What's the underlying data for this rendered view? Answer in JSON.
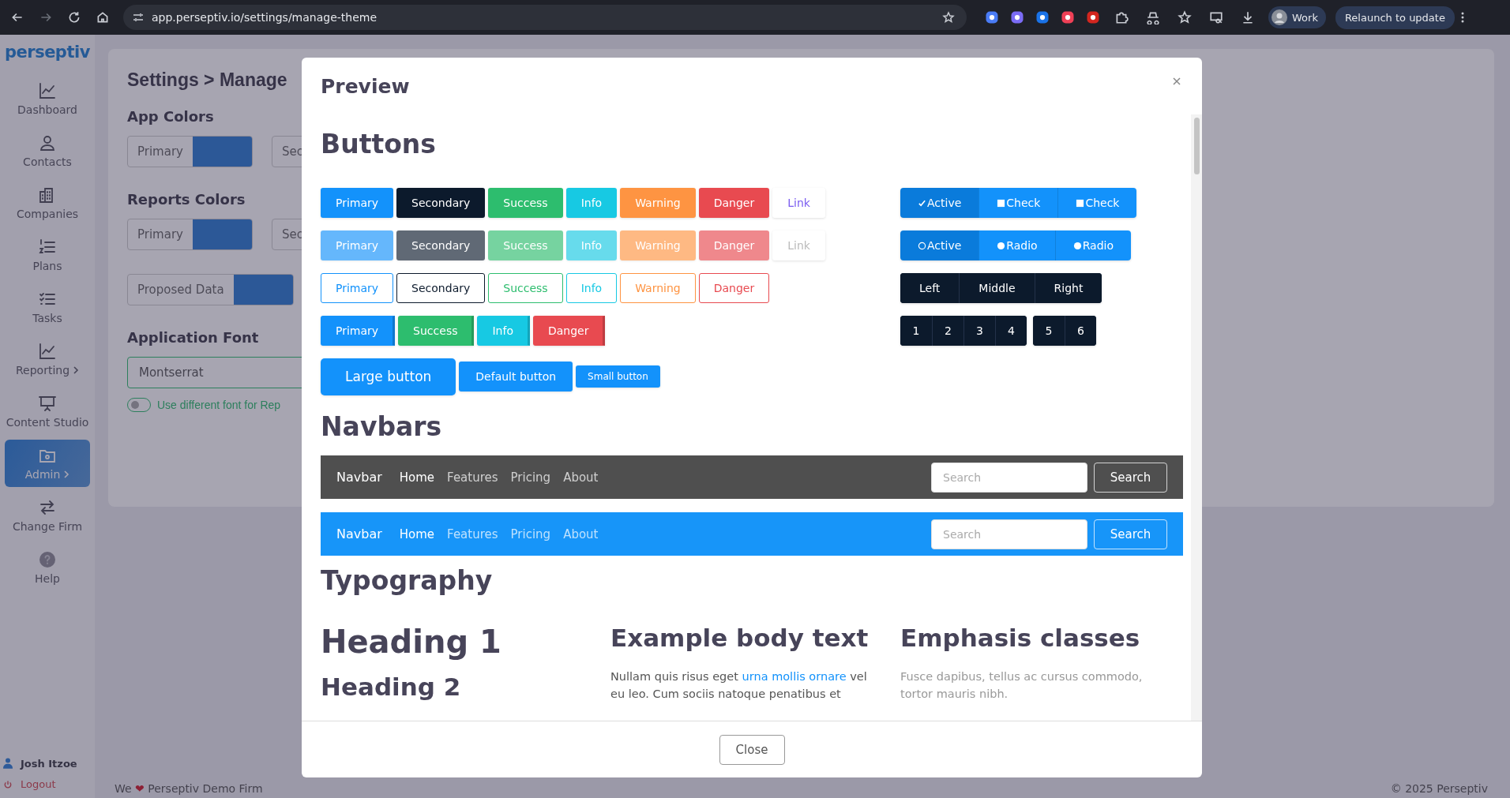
{
  "browser": {
    "url": "app.perseptiv.io/settings/manage-theme",
    "profile": "Work",
    "relaunch": "Relaunch to update"
  },
  "sidebar": {
    "logo": "perseptiv",
    "items": [
      {
        "label": "Dashboard",
        "submenu": false,
        "selected": false
      },
      {
        "label": "Contacts",
        "submenu": false,
        "selected": false
      },
      {
        "label": "Companies",
        "submenu": false,
        "selected": false
      },
      {
        "label": "Plans",
        "submenu": false,
        "selected": false
      },
      {
        "label": "Tasks",
        "submenu": false,
        "selected": false
      },
      {
        "label": "Reporting",
        "submenu": true,
        "selected": false
      },
      {
        "label": "Content Studio",
        "submenu": false,
        "selected": false
      },
      {
        "label": "Admin",
        "submenu": true,
        "selected": true
      },
      {
        "label": "Change Firm",
        "submenu": false,
        "selected": false
      },
      {
        "label": "Help",
        "submenu": false,
        "selected": false
      }
    ],
    "user": "Josh Itzoe",
    "logout": "Logout"
  },
  "settings": {
    "title": "Settings > Manage",
    "sections": [
      {
        "heading": "App Colors",
        "rows": [
          [
            "Primary",
            "Sec"
          ]
        ]
      },
      {
        "heading": "Reports Colors",
        "rows": [
          [
            "Primary",
            "Sec"
          ],
          [
            "Proposed Data"
          ]
        ]
      }
    ],
    "font": {
      "heading": "Application Font",
      "value": "Montserrat",
      "toggle": {
        "on": false,
        "label": "Use different font for Rep"
      }
    }
  },
  "footer": {
    "left_before": "We",
    "heart": "❤",
    "left_after": "Perseptiv Demo Firm",
    "right": "© 2025 Perseptiv"
  },
  "modal": {
    "title": "Preview",
    "close_button": "Close",
    "buttons": {
      "heading": "Buttons",
      "rows": [
        {
          "kind": "solid",
          "items": [
            {
              "label": "Primary",
              "kind": "primary"
            },
            {
              "label": "Secondary",
              "kind": "secondary"
            },
            {
              "label": "Success",
              "kind": "success"
            },
            {
              "label": "Info",
              "kind": "info"
            },
            {
              "label": "Warning",
              "kind": "warning"
            },
            {
              "label": "Danger",
              "kind": "danger"
            },
            {
              "label": "Link",
              "kind": "link"
            }
          ]
        },
        {
          "kind": "disabled",
          "items": [
            {
              "label": "Primary",
              "kind": "primary"
            },
            {
              "label": "Secondary",
              "kind": "secondary"
            },
            {
              "label": "Success",
              "kind": "success"
            },
            {
              "label": "Info",
              "kind": "info"
            },
            {
              "label": "Warning",
              "kind": "warning"
            },
            {
              "label": "Danger",
              "kind": "danger"
            },
            {
              "label": "Link",
              "kind": "link"
            }
          ]
        },
        {
          "kind": "outline",
          "items": [
            {
              "label": "Primary",
              "kind": "primary"
            },
            {
              "label": "Secondary",
              "kind": "secondary"
            },
            {
              "label": "Success",
              "kind": "success"
            },
            {
              "label": "Info",
              "kind": "info"
            },
            {
              "label": "Warning",
              "kind": "warning"
            },
            {
              "label": "Danger",
              "kind": "danger"
            }
          ]
        },
        {
          "kind": "split",
          "items": [
            {
              "label": "Primary",
              "kind": "primary"
            },
            {
              "label": "Success",
              "kind": "success"
            },
            {
              "label": "Info",
              "kind": "info"
            },
            {
              "label": "Danger",
              "kind": "danger"
            }
          ]
        }
      ],
      "sizes": [
        {
          "label": "Large button",
          "kind": "large"
        },
        {
          "label": "Default button",
          "kind": "default"
        },
        {
          "label": "Small button",
          "kind": "small"
        }
      ],
      "toggle_groups": [
        {
          "items": [
            {
              "label": "Active",
              "kind": "checkbox",
              "checked": true,
              "selected": true
            },
            {
              "label": "Check",
              "kind": "checkbox",
              "checked": false,
              "selected": false
            },
            {
              "label": "Check",
              "kind": "checkbox",
              "checked": false,
              "selected": false
            }
          ]
        },
        {
          "items": [
            {
              "label": "Active",
              "kind": "radio",
              "checked": true,
              "selected": true
            },
            {
              "label": "Radio",
              "kind": "radio",
              "checked": false,
              "selected": false
            },
            {
              "label": "Radio",
              "kind": "radio",
              "checked": false,
              "selected": false
            }
          ]
        }
      ],
      "segments": [
        "Left",
        "Middle",
        "Right"
      ],
      "pagination": [
        [
          "1",
          "2",
          "3",
          "4"
        ],
        [
          "5",
          "6"
        ]
      ]
    },
    "navbars": {
      "heading": "Navbars",
      "bars": [
        {
          "kind": "dark",
          "brand": "Navbar",
          "links": [
            {
              "label": "Home",
              "selected": true
            },
            {
              "label": "Features",
              "selected": false
            },
            {
              "label": "Pricing",
              "selected": false
            },
            {
              "label": "About",
              "selected": false
            }
          ],
          "placeholder": "Search",
          "button": "Search"
        },
        {
          "kind": "primary",
          "brand": "Navbar",
          "links": [
            {
              "label": "Home",
              "selected": true
            },
            {
              "label": "Features",
              "selected": false
            },
            {
              "label": "Pricing",
              "selected": false
            },
            {
              "label": "About",
              "selected": false
            }
          ],
          "placeholder": "Search",
          "button": "Search"
        }
      ]
    },
    "typography": {
      "heading": "Typography",
      "headings": [
        {
          "text": "Heading 1",
          "kind": "first"
        },
        {
          "text": "Heading 2",
          "kind": "second"
        }
      ],
      "body": {
        "heading": "Example body text",
        "before": "Nullam quis risus eget",
        "link": "urna mollis ornare",
        "after": "vel eu leo. Cum sociis natoque penatibus et"
      },
      "emphasis": {
        "heading": "Emphasis classes",
        "text": "Fusce dapibus, tellus ac cursus commodo, tortor mauris nibh."
      }
    }
  }
}
